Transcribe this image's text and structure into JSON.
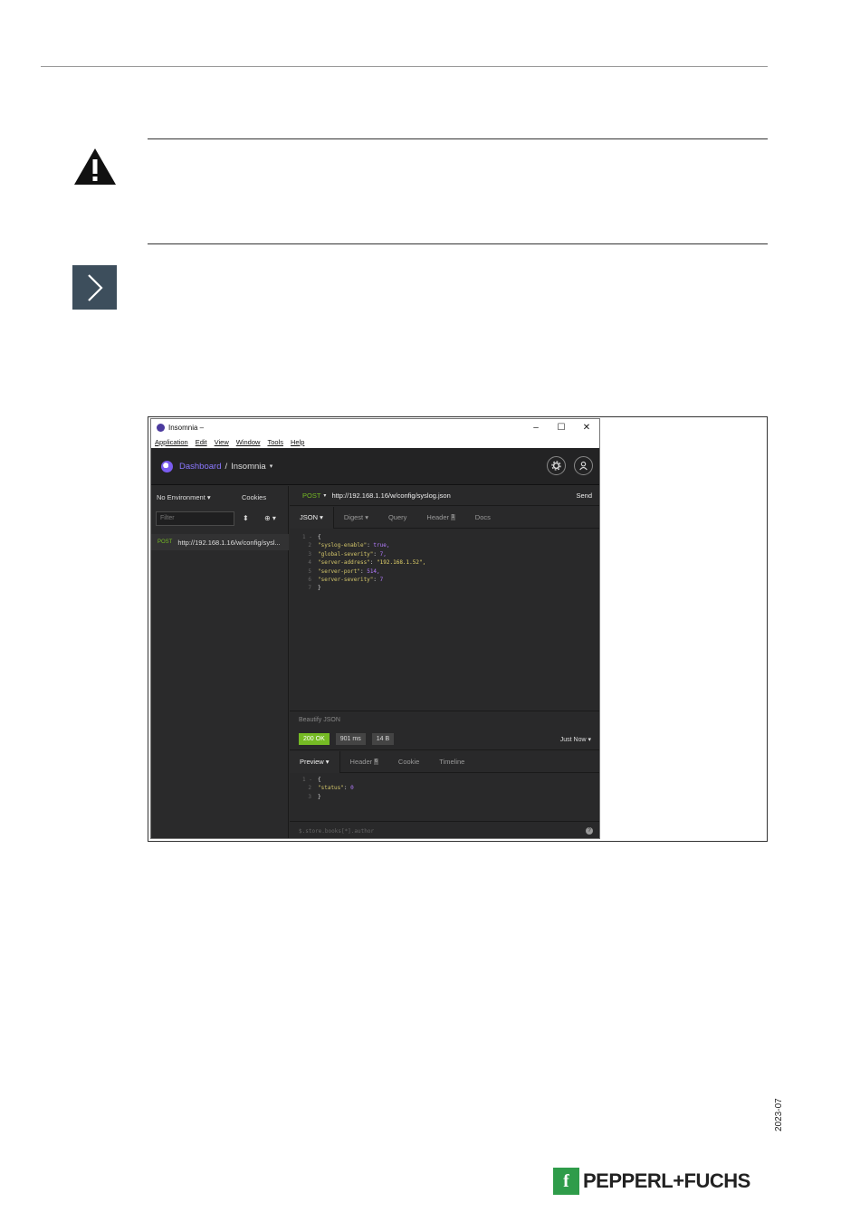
{
  "document": {
    "date_code": "2023-07",
    "brand_mark": "f",
    "brand": "PEPPERL+FUCHS"
  },
  "window": {
    "title": "Insomnia –",
    "controls": [
      "–",
      "☐",
      "✕"
    ],
    "menu": [
      "Application",
      "Edit",
      "View",
      "Window",
      "Tools",
      "Help"
    ]
  },
  "header": {
    "dashboard": "Dashboard",
    "separator": "/",
    "workspace": "Insomnia",
    "caret": "▾",
    "settings_icon": "gear-icon",
    "account_icon": "user-icon"
  },
  "sidebar": {
    "environment": "No Environment ▾",
    "cookies": "Cookies",
    "filter_placeholder": "Filter",
    "sort": "⬍",
    "add": "⊕ ▾",
    "requests": [
      {
        "method": "POST",
        "url": "http://192.168.1.16/w/config/sysl..."
      }
    ]
  },
  "request": {
    "method": "POST",
    "method_caret": "▾",
    "url": "http://192.168.1.16/w/config/syslog.json",
    "send": "Send",
    "tabs": [
      "JSON ▾",
      "Digest ▾",
      "Query",
      "Header",
      "Docs"
    ],
    "header_count": "1",
    "body_lines": [
      {
        "n": "1 -",
        "text": "{"
      },
      {
        "n": "2",
        "key": "\"syslog-enable\"",
        "value": "true,"
      },
      {
        "n": "3",
        "key": "\"global-severity\"",
        "value": "7,"
      },
      {
        "n": "4",
        "key": "\"server-address\"",
        "value": "\"192.168.1.52\","
      },
      {
        "n": "5",
        "key": "\"server-port\"",
        "value": "514,"
      },
      {
        "n": "6",
        "key": "\"server-severity\"",
        "value": "7"
      },
      {
        "n": "7",
        "text": "}"
      }
    ],
    "beautify": "Beautify JSON"
  },
  "response": {
    "status": "200 OK",
    "duration": "901 ms",
    "size": "14 B",
    "time": "Just Now ▾",
    "tabs": [
      "Preview ▾",
      "Header",
      "Cookie",
      "Timeline"
    ],
    "header_count": "6",
    "body_lines": [
      {
        "n": "1 -",
        "text": "{"
      },
      {
        "n": "2",
        "key": "\"status\"",
        "value": "0"
      },
      {
        "n": "3",
        "text": "}"
      }
    ],
    "filter_placeholder": "$.store.books[*].author",
    "help": "?"
  },
  "colors": {
    "accent": "#8b78ff",
    "method_post": "#75ba24",
    "status_ok": "#75ba24",
    "brand_green": "#2f9c4a",
    "step_icon": "#3d4e5c"
  }
}
